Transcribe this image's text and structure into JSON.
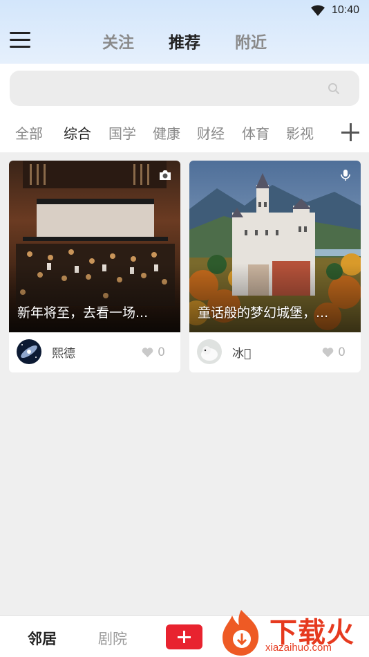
{
  "status": {
    "time": "10:40"
  },
  "header": {
    "tabs": [
      {
        "label": "关注"
      },
      {
        "label": "推荐"
      },
      {
        "label": "附近"
      }
    ]
  },
  "search": {
    "placeholder": ""
  },
  "categories": [
    "全部",
    "综合",
    "国学",
    "健康",
    "财经",
    "体育",
    "影视"
  ],
  "feed": [
    {
      "title": "新年将至，去看一场...",
      "author": "熙德",
      "likes": "0",
      "media_icon": "camera-icon"
    },
    {
      "title": "童话般的梦幻城堡，...",
      "author": "冰\u0000",
      "likes": "0",
      "media_icon": "microphone-icon"
    }
  ],
  "bottom_nav": {
    "home": "邻居",
    "theater": "剧院"
  },
  "watermark": {
    "brand": "下载火",
    "domain": "xiazaihuo.com"
  },
  "colors": {
    "accent": "#e8232f",
    "header_bg": "#d3e6fb"
  }
}
